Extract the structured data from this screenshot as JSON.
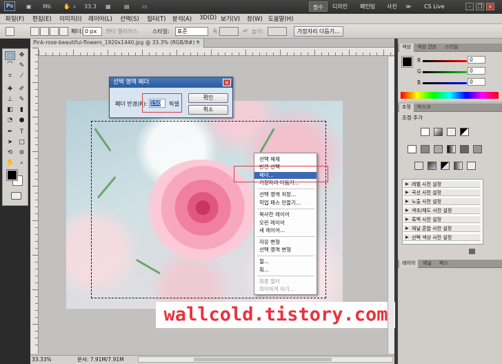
{
  "app": {
    "logo": "Ps",
    "zoom_value": "33.3",
    "workspaces": [
      "필수",
      "디자인",
      "페인팅",
      "사진"
    ],
    "more": "≫",
    "cslive": "CS Live"
  },
  "menu": [
    "파일(F)",
    "편집(E)",
    "이미지(I)",
    "레이어(L)",
    "선택(S)",
    "필터(T)",
    "분석(A)",
    "3D(D)",
    "보기(V)",
    "창(W)",
    "도움말(H)"
  ],
  "options": {
    "feather_label": "페더:",
    "feather_value": "0 px",
    "antialias_label": "앤티 앨리어스",
    "style_label": "스타일:",
    "style_value": "표준",
    "width_label": "폭:",
    "height_label": "높이:",
    "refine_edge_button": "가장자리 다듬기..."
  },
  "document": {
    "tab_title": "Pink-rose-beautiful-flowers_1920x1440.jpg @ 33.3% (RGB/8#) *",
    "close": "×"
  },
  "dialog": {
    "title": "선택 영역 페더",
    "radius_label": "페더 반경(R):",
    "radius_value": "150",
    "unit": "픽셀",
    "ok_button": "확인",
    "cancel_button": "취소",
    "close": "×"
  },
  "context_menu": {
    "items": [
      {
        "label": "선택 해제",
        "state": "normal"
      },
      {
        "label": "반전 선택",
        "state": "normal"
      },
      {
        "label": "페더...",
        "state": "highlighted"
      },
      {
        "label": "가장자리 다듬기...",
        "state": "normal"
      },
      {
        "label": "선택 영역 저장...",
        "state": "normal"
      },
      {
        "label": "작업 패스 만들기...",
        "state": "normal"
      },
      {
        "label": "복사한 레이어",
        "state": "normal"
      },
      {
        "label": "오린 레이어",
        "state": "normal"
      },
      {
        "label": "새 레이어...",
        "state": "normal"
      },
      {
        "label": "자유 변형",
        "state": "normal"
      },
      {
        "label": "선택 영역 변형",
        "state": "normal"
      },
      {
        "label": "칠...",
        "state": "normal"
      },
      {
        "label": "획...",
        "state": "normal"
      },
      {
        "label": "최종 필터",
        "state": "disabled"
      },
      {
        "label": "희미하게 하기...",
        "state": "disabled"
      }
    ]
  },
  "watermark": "wallcold.tistory.com",
  "status": {
    "zoom": "33.33%",
    "doc_info": "문서: 7.91M/7.91M"
  },
  "panels": {
    "color_tabs": [
      "색상",
      "색상 견본",
      "스타일"
    ],
    "r_label": "R",
    "g_label": "G",
    "b_label": "B",
    "r_value": "0",
    "g_value": "0",
    "b_value": "0",
    "adjust_tabs": [
      "조정",
      "마스크"
    ],
    "adjust_title": "조정 추가",
    "presets": [
      "레벨 사전 설정",
      "곡선 사전 설정",
      "노출 사전 설정",
      "색조/채도 사전 설정",
      "흑백 사전 설정",
      "채널 혼합 사전 설정",
      "선택 색상 사전 설정"
    ],
    "layer_tabs": [
      "레이어",
      "채널",
      "패스"
    ]
  },
  "colors": {
    "accent": "#3d68b4",
    "highlight_box": "#e0393d",
    "watermark": "#e8323e"
  }
}
